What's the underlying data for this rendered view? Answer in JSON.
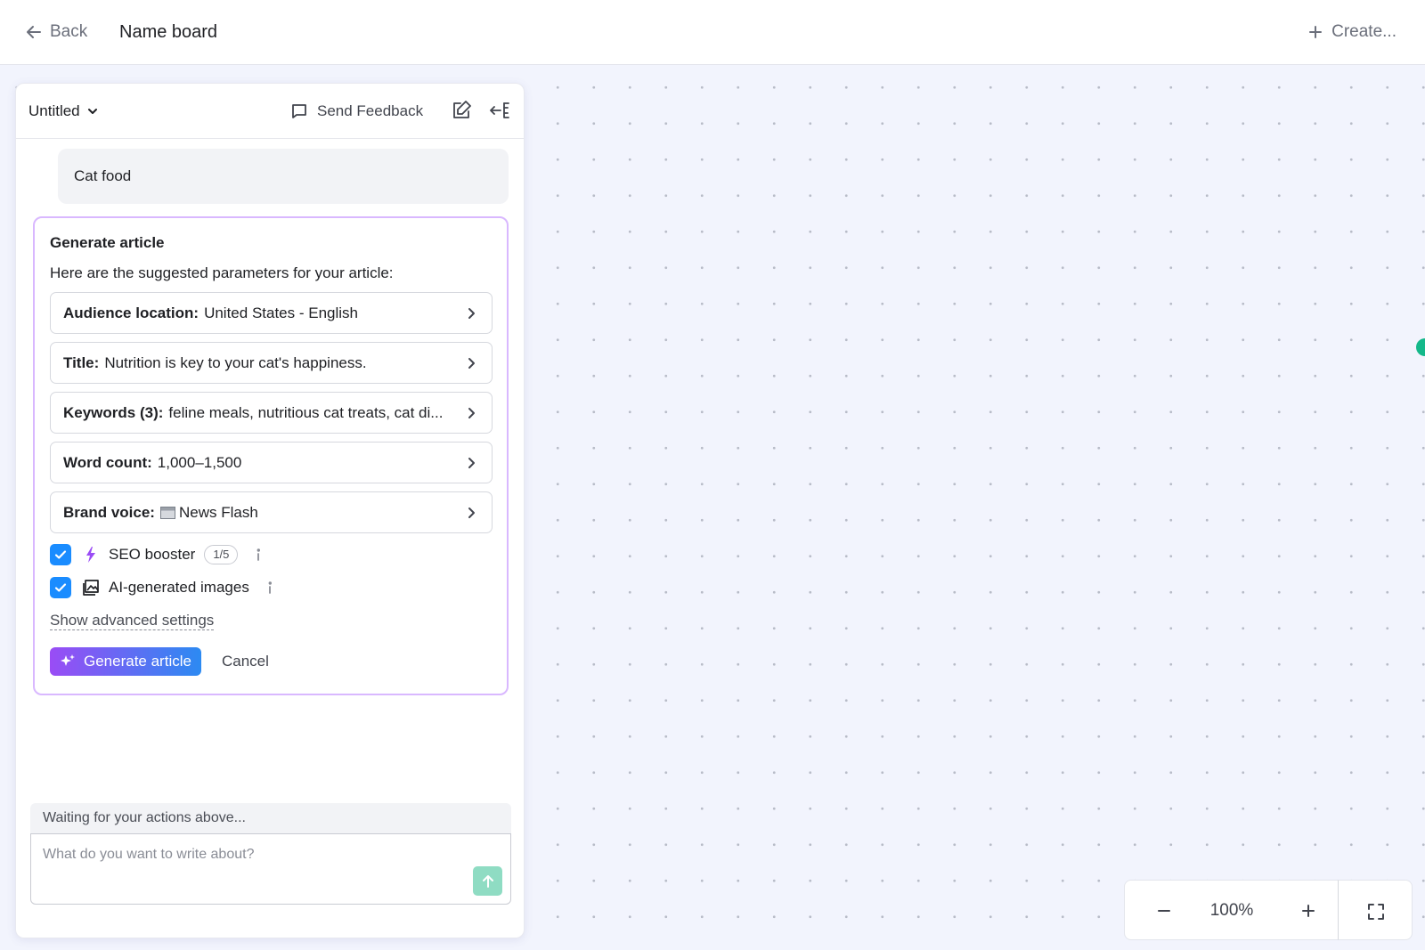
{
  "header": {
    "back_label": "Back",
    "board_name": "Name board",
    "create_label": "Create..."
  },
  "panel": {
    "doc_title": "Untitled",
    "feedback_label": "Send Feedback",
    "user_message": "Cat food",
    "generate_card": {
      "title": "Generate article",
      "subtitle": "Here are the suggested parameters for your article:",
      "params": [
        {
          "key": "Audience location:",
          "value": "United States - English"
        },
        {
          "key": "Title:",
          "value": "Nutrition is key to your cat's happiness."
        },
        {
          "key": "Keywords (3):",
          "value": "feline meals, nutritious cat treats, cat di..."
        },
        {
          "key": "Word count:",
          "value": "1,000–1,500"
        },
        {
          "key": "Brand voice:",
          "value": "News Flash",
          "icon": "newspaper-icon"
        }
      ],
      "options": [
        {
          "label": "SEO booster",
          "checked": true,
          "icon": "lightning-icon",
          "badge": "1/5"
        },
        {
          "label": "AI-generated images",
          "checked": true,
          "icon": "image-gallery-icon"
        }
      ],
      "advanced_link": "Show advanced settings",
      "generate_button": "Generate article",
      "cancel_button": "Cancel"
    },
    "status_text": "Waiting for your actions above...",
    "prompt": {
      "placeholder": "What do you want to write about?",
      "value": ""
    }
  },
  "zoom": {
    "level": "100%"
  },
  "colors": {
    "accent_purple": "#9a4cf5",
    "accent_blue": "#2c8af2",
    "checkbox_blue": "#1a8cff",
    "card_border": "#d9b8ff",
    "send_green": "#8fdcc3",
    "canvas_bg": "#f2f4fd",
    "status_green": "#14b88a"
  }
}
